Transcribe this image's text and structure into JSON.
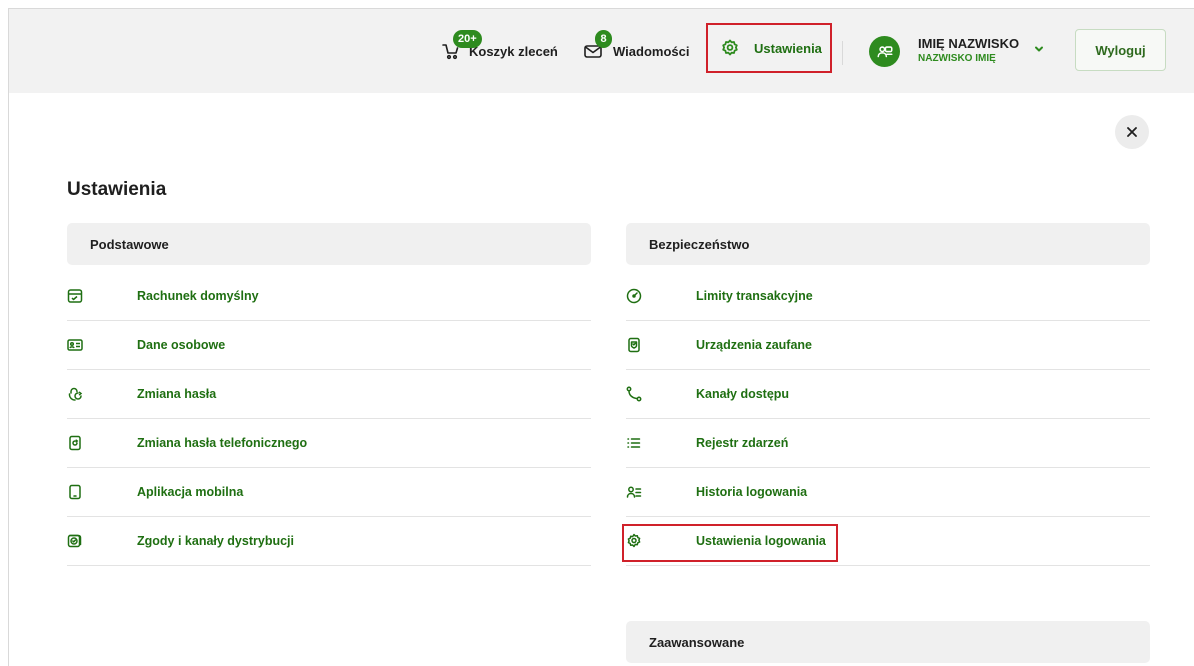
{
  "header": {
    "cart": {
      "badge": "20+",
      "label": "Koszyk zleceń",
      "icon": "cart-icon"
    },
    "messages": {
      "badge": "8",
      "label": "Wiadomości",
      "icon": "envelope-icon"
    },
    "settings": {
      "label": "Ustawienia",
      "icon": "gear-icon"
    },
    "user": {
      "name": "IMIĘ NAZWISKO",
      "subname": "NAZWISKO IMIĘ",
      "icon": "user-group-icon"
    },
    "logout_label": "Wyloguj"
  },
  "page": {
    "title": "Ustawienia",
    "close_icon": "close-icon"
  },
  "sections": {
    "basic": {
      "title": "Podstawowe",
      "items": [
        {
          "label": "Rachunek domyślny",
          "icon": "account-card-icon"
        },
        {
          "label": "Dane osobowe",
          "icon": "id-card-icon"
        },
        {
          "label": "Zmiana hasła",
          "icon": "password-refresh-icon"
        },
        {
          "label": "Zmiana hasła telefonicznego",
          "icon": "phone-refresh-icon"
        },
        {
          "label": "Aplikacja mobilna",
          "icon": "mobile-phone-icon"
        },
        {
          "label": "Zgody i kanały dystrybucji",
          "icon": "consent-check-icon"
        }
      ]
    },
    "security": {
      "title": "Bezpieczeństwo",
      "items": [
        {
          "label": "Limity transakcyjne",
          "icon": "gauge-icon"
        },
        {
          "label": "Urządzenia zaufane",
          "icon": "trusted-device-icon"
        },
        {
          "label": "Kanały dostępu",
          "icon": "route-icon"
        },
        {
          "label": "Rejestr zdarzeń",
          "icon": "list-icon"
        },
        {
          "label": "Historia logowania",
          "icon": "user-list-icon"
        },
        {
          "label": "Ustawienia logowania",
          "icon": "gear-icon"
        }
      ]
    },
    "advanced": {
      "title": "Zaawansowane"
    }
  },
  "colors": {
    "accent": "#2e8b1f",
    "link": "#1f6f12",
    "highlight": "#d0212a",
    "topbar": "#f2f2f2"
  }
}
